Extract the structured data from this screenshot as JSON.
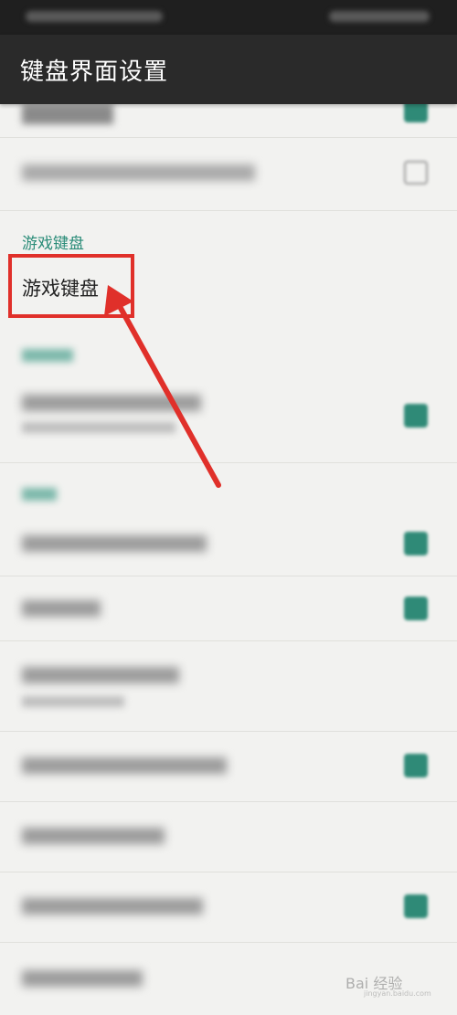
{
  "header": {
    "title": "键盘界面设置"
  },
  "sections": {
    "game_keyboard_header": "游戏键盘",
    "game_keyboard_item": "游戏键盘"
  },
  "watermark": {
    "text": "Bai 经验",
    "url": "jingyan.baidu.com"
  },
  "colors": {
    "accent": "#2a8c78",
    "highlight": "#e0302a",
    "appbar": "#2a2a2a"
  }
}
